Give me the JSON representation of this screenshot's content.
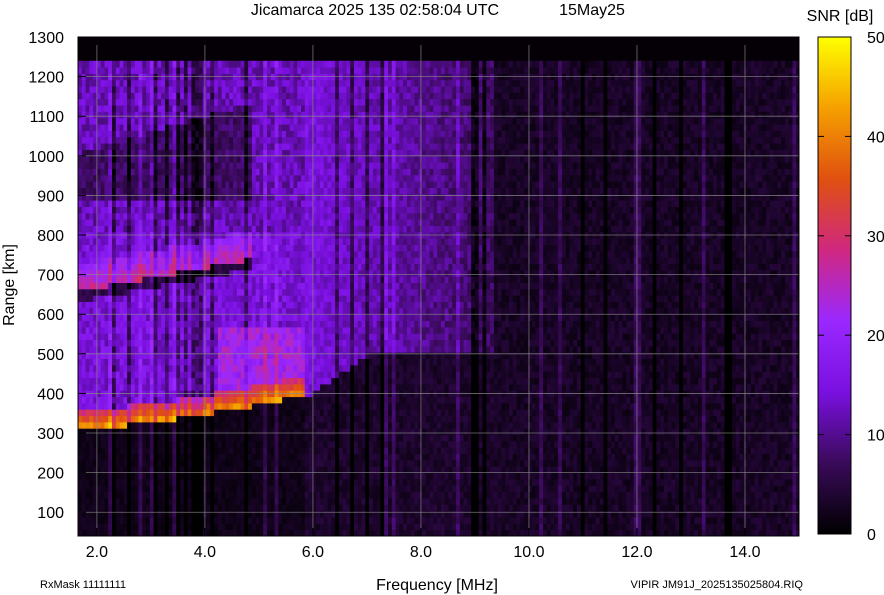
{
  "chart_data": {
    "type": "heatmap",
    "title": "Jicamarca 2025 135 02:58:04 UTC",
    "date_label": "15May25",
    "xlabel": "Frequency [MHz]",
    "ylabel": "Range [km]",
    "colorbar_label": "SNR [dB]",
    "xlim": [
      1.65,
      15.0
    ],
    "ylim": [
      40,
      1300
    ],
    "x_ticks": [
      2.0,
      4.0,
      6.0,
      8.0,
      10.0,
      12.0,
      14.0
    ],
    "x_tick_labels": [
      "2.0",
      "4.0",
      "6.0",
      "8.0",
      "10.0",
      "12.0",
      "14.0"
    ],
    "y_ticks": [
      100,
      200,
      300,
      400,
      500,
      600,
      700,
      800,
      900,
      1000,
      1100,
      1200,
      1300
    ],
    "y_tick_labels": [
      "100",
      "200",
      "300",
      "400",
      "500",
      "600",
      "700",
      "800",
      "900",
      "1000",
      "1100",
      "1200",
      "1300"
    ],
    "colorbar_range": [
      0,
      50
    ],
    "colorbar_ticks": [
      0,
      10,
      20,
      30,
      40,
      50
    ],
    "colorbar_tick_labels": [
      "0",
      "10",
      "20",
      "30",
      "40",
      "50"
    ],
    "colormap_stops": [
      "#000000",
      "#3a0a5a",
      "#7a10e0",
      "#9a28ff",
      "#d02880",
      "#e05010",
      "#f5a000",
      "#ffff00"
    ],
    "grid": true,
    "data_range_top_km": 1240,
    "features": [
      {
        "name": "F-layer trace",
        "freq_range_mhz": [
          1.65,
          5.8
        ],
        "range_start_km": 310,
        "range_end_km": 395,
        "peak_snr_db": 38
      },
      {
        "name": "F-layer trace (second hop)",
        "freq_range_mhz": [
          1.65,
          4.8
        ],
        "range_start_km": 650,
        "range_end_km": 730,
        "peak_snr_db": 25
      },
      {
        "name": "diffuse echo boundary",
        "freq_range_mhz": [
          7.0,
          9.3
        ],
        "range_km": 500
      }
    ],
    "bottom_left_label": "RxMask 11111111",
    "bottom_right_label": "VIPIR  JM91J_2025135025804.RIQ"
  }
}
